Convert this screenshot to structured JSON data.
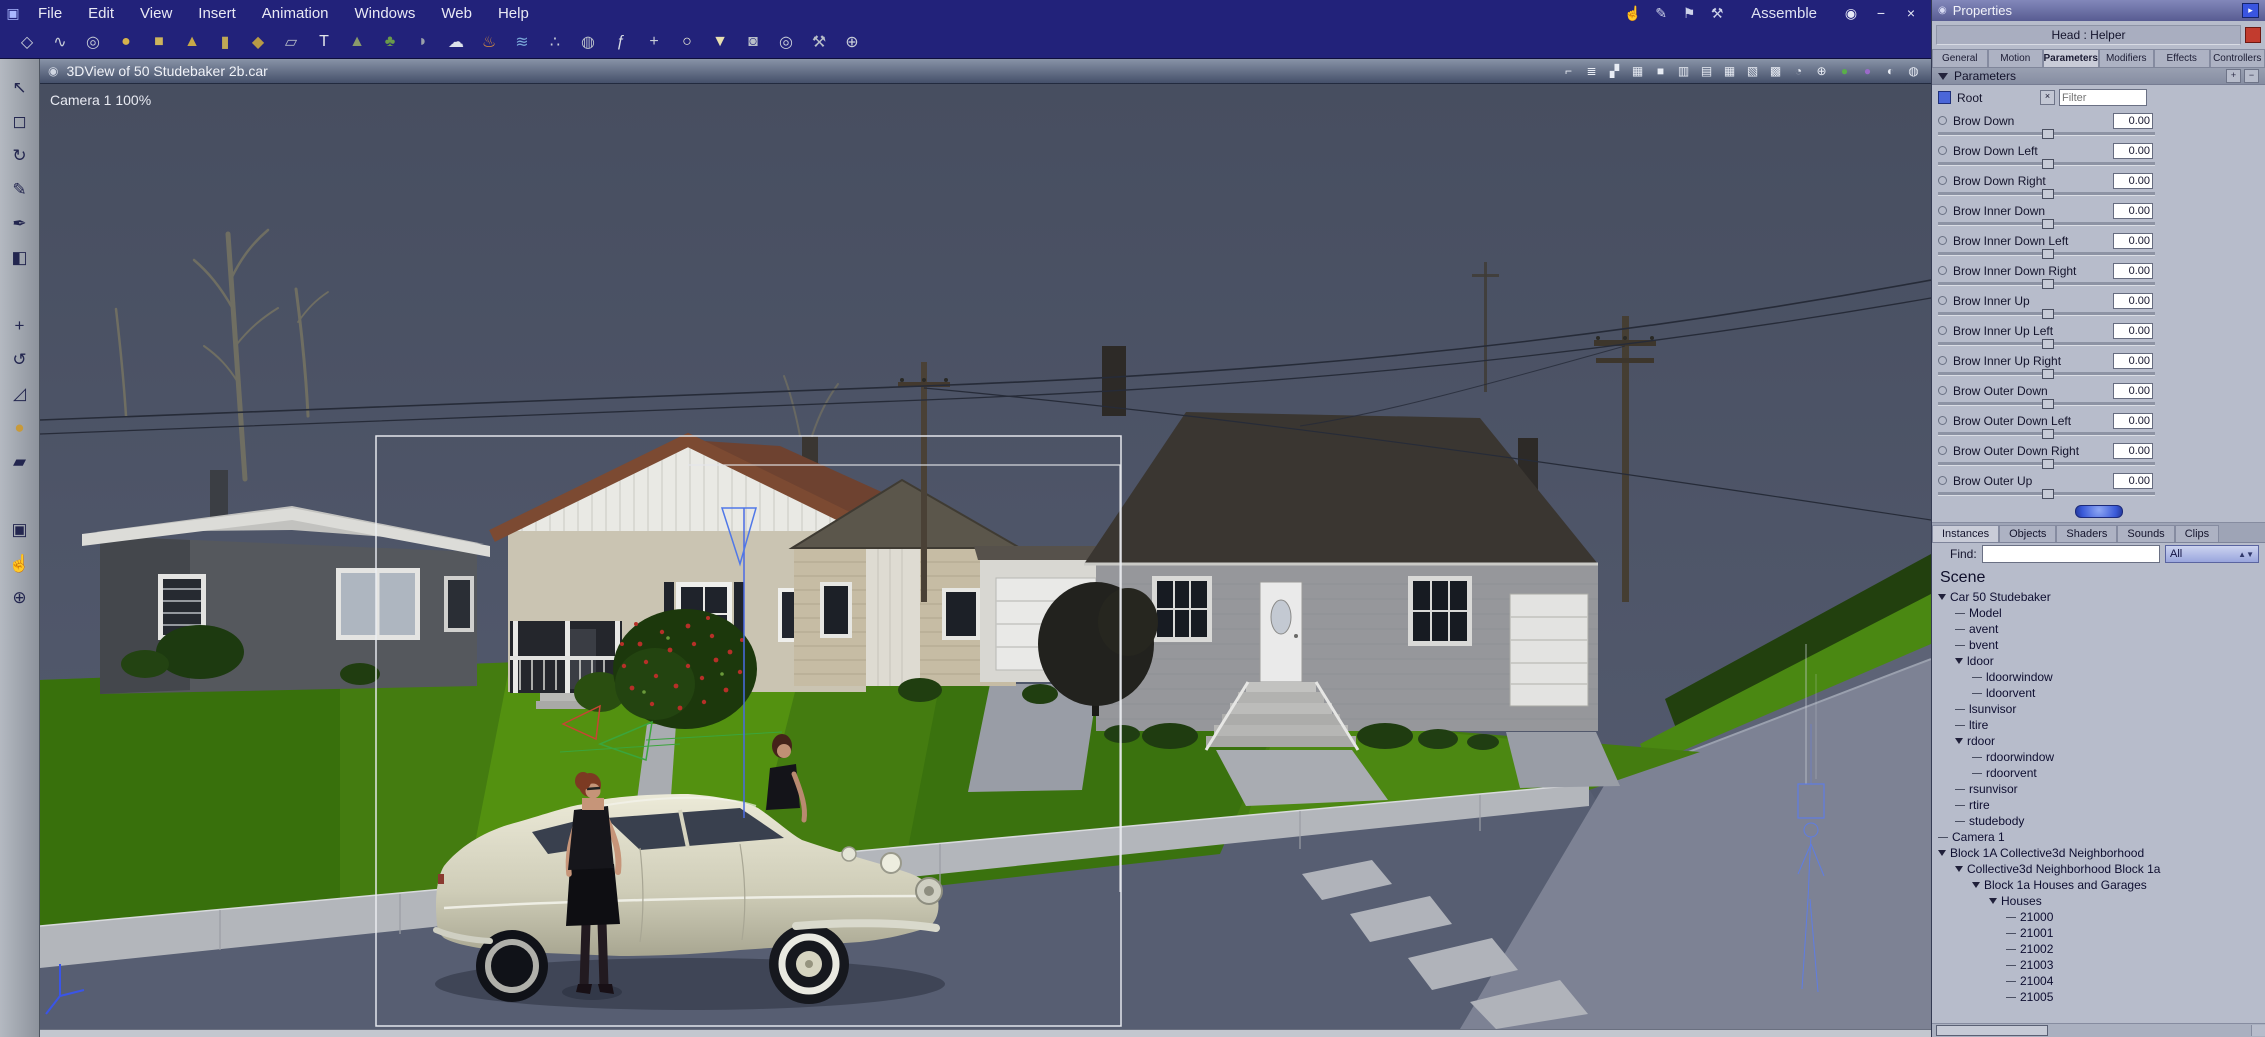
{
  "menu": {
    "items": [
      "File",
      "Edit",
      "View",
      "Insert",
      "Animation",
      "Windows",
      "Web",
      "Help"
    ],
    "right_icons": [
      {
        "name": "pan-hand-icon",
        "glyph": "☝"
      },
      {
        "name": "pen-icon",
        "glyph": "✎"
      },
      {
        "name": "flag-icon",
        "glyph": "⚑"
      },
      {
        "name": "tools-icon",
        "glyph": "⚒"
      }
    ],
    "mode_label": "Assemble",
    "window_icons": [
      {
        "name": "visibility-eye-icon",
        "glyph": "◉"
      },
      {
        "name": "minimize-button",
        "glyph": "−"
      },
      {
        "name": "close-button",
        "glyph": "×"
      }
    ]
  },
  "toolbar": {
    "tools": [
      {
        "name": "vertex-model-tool-icon",
        "glyph": "◇",
        "color": "#c8cdd8"
      },
      {
        "name": "spline-model-tool-icon",
        "glyph": "∿",
        "color": "#c8cdd8"
      },
      {
        "name": "metaball-tool-icon",
        "glyph": "◎",
        "color": "#c2c8d4"
      },
      {
        "name": "sphere-primitive-icon",
        "glyph": "●",
        "color": "#d6b24c"
      },
      {
        "name": "cube-primitive-icon",
        "glyph": "■",
        "color": "#cdb45c"
      },
      {
        "name": "cone-primitive-icon",
        "glyph": "▲",
        "color": "#c8a948"
      },
      {
        "name": "cylinder-primitive-icon",
        "glyph": "▮",
        "color": "#bfa855"
      },
      {
        "name": "icosahedron-primitive-icon",
        "glyph": "◆",
        "color": "#b89a46"
      },
      {
        "name": "plane-primitive-icon",
        "glyph": "▱",
        "color": "#b4bac6"
      },
      {
        "name": "text-primitive-icon",
        "glyph": "T",
        "color": "#e2e5ea"
      },
      {
        "name": "terrain-tool-icon",
        "glyph": "▲",
        "color": "#8a9a6a"
      },
      {
        "name": "plant-tool-icon",
        "glyph": "♣",
        "color": "#6a9a4a"
      },
      {
        "name": "rock-tool-icon",
        "glyph": "◗",
        "color": "#9aa0aa"
      },
      {
        "name": "cloud-tool-icon",
        "glyph": "☁",
        "color": "#dde2ea"
      },
      {
        "name": "fire-tool-icon",
        "glyph": "♨",
        "color": "#d89040"
      },
      {
        "name": "fountain-tool-icon",
        "glyph": "≋",
        "color": "#7aa8d8"
      },
      {
        "name": "particles-tool-icon",
        "glyph": "∴",
        "color": "#c8cdd8"
      },
      {
        "name": "blob-tool-icon",
        "glyph": "◍",
        "color": "#b8bec8"
      },
      {
        "name": "formula-tool-icon",
        "glyph": "ƒ",
        "color": "#d8dce4"
      },
      {
        "name": "modifier-tool-icon",
        "glyph": "+",
        "color": "#c8cdd8"
      },
      {
        "name": "bulb-light-tool-icon",
        "glyph": "○",
        "color": "#f0f0d8"
      },
      {
        "name": "spot-light-tool-icon",
        "glyph": "▼",
        "color": "#e8e0b0"
      },
      {
        "name": "camera-tool-icon",
        "glyph": "◙",
        "color": "#b8bec8"
      },
      {
        "name": "target-helper-tool-icon",
        "glyph": "◎",
        "color": "#c8cdd8"
      },
      {
        "name": "wrench-tool-icon",
        "glyph": "⚒",
        "color": "#b8bec8"
      },
      {
        "name": "magnifier-tool-icon",
        "glyph": "⊕",
        "color": "#c8cdd8"
      }
    ]
  },
  "left_toolbar": {
    "tools": [
      {
        "name": "pointer-tool-icon",
        "glyph": "↖"
      },
      {
        "name": "marquee-tool-icon",
        "glyph": "◻"
      },
      {
        "name": "rotate-scene-tool-icon",
        "glyph": "↻"
      },
      {
        "name": "pen-tool-icon",
        "glyph": "✎"
      },
      {
        "name": "eyedropper-tool-icon",
        "glyph": "✒"
      },
      {
        "name": "bucket-tool-icon",
        "glyph": "◧"
      },
      {
        "name": "gap-1",
        "glyph": ""
      },
      {
        "name": "move-tool-icon",
        "glyph": "+"
      },
      {
        "name": "rotate-tool-icon",
        "glyph": "↺"
      },
      {
        "name": "scale-tool-icon",
        "glyph": "◿"
      },
      {
        "name": "reference-sphere-icon",
        "glyph": "●",
        "color": "#c89a3a"
      },
      {
        "name": "shear-tool-icon",
        "glyph": "▰"
      },
      {
        "name": "gap-2",
        "glyph": ""
      },
      {
        "name": "camera-track-tool-icon",
        "glyph": "▣"
      },
      {
        "name": "hand-pan-tool-icon",
        "glyph": "☝"
      },
      {
        "name": "zoom-tool-icon",
        "glyph": "⊕"
      }
    ]
  },
  "viewport": {
    "title": "3DView of 50 Studebaker 2b.car",
    "camera_label": "Camera 1 100%",
    "title_icons": [
      {
        "name": "snap-magnet-icon",
        "glyph": "⌐"
      },
      {
        "name": "measure-icon",
        "glyph": "≣"
      },
      {
        "name": "antialias-icon",
        "glyph": "▞"
      },
      {
        "name": "grid-toggle-icon",
        "glyph": "▦"
      },
      {
        "name": "layout-full-icon",
        "glyph": "■"
      },
      {
        "name": "layout-columns-icon",
        "glyph": "▥"
      },
      {
        "name": "layout-rows-icon",
        "glyph": "▤"
      },
      {
        "name": "layout-quad-icon",
        "glyph": "▦"
      },
      {
        "name": "layout-three-icon",
        "glyph": "▧"
      },
      {
        "name": "layout-custom-icon",
        "glyph": "▩"
      },
      {
        "name": "timer-icon",
        "glyph": "◔"
      },
      {
        "name": "axis-toggle-icon",
        "glyph": "⊕"
      },
      {
        "name": "preview-sphere-green-icon",
        "glyph": "●",
        "color": "#5aae4a"
      },
      {
        "name": "preview-sphere-purple-icon",
        "glyph": "●",
        "color": "#9a6ac8"
      },
      {
        "name": "render-mode-icon",
        "glyph": "◐"
      },
      {
        "name": "info-icon",
        "glyph": "◍"
      }
    ]
  },
  "properties": {
    "panel_title": "Properties",
    "selection_label": "Head : Helper",
    "tabs": [
      {
        "label": "General"
      },
      {
        "label": "Motion"
      },
      {
        "label": "Parameters",
        "selected": true
      },
      {
        "label": "Modifiers"
      },
      {
        "label": "Effects"
      },
      {
        "label": "Controllers"
      }
    ],
    "section_title": "Parameters",
    "root_label": "Root",
    "filter_placeholder": "Filter",
    "params": [
      {
        "label": "Brow Down",
        "value": "0.00"
      },
      {
        "label": "Brow Down Left",
        "value": "0.00"
      },
      {
        "label": "Brow Down Right",
        "value": "0.00"
      },
      {
        "label": "Brow Inner Down",
        "value": "0.00"
      },
      {
        "label": "Brow Inner Down Left",
        "value": "0.00"
      },
      {
        "label": "Brow Inner Down Right",
        "value": "0.00"
      },
      {
        "label": "Brow Inner Up",
        "value": "0.00"
      },
      {
        "label": "Brow Inner Up Left",
        "value": "0.00"
      },
      {
        "label": "Brow Inner Up Right",
        "value": "0.00"
      },
      {
        "label": "Brow Outer Down",
        "value": "0.00"
      },
      {
        "label": "Brow Outer Down Left",
        "value": "0.00"
      },
      {
        "label": "Brow Outer Down Right",
        "value": "0.00"
      },
      {
        "label": "Brow Outer Up",
        "value": "0.00"
      }
    ]
  },
  "browser": {
    "tabs": [
      {
        "label": "Instances",
        "selected": true
      },
      {
        "label": "Objects"
      },
      {
        "label": "Shaders"
      },
      {
        "label": "Sounds"
      },
      {
        "label": "Clips"
      }
    ],
    "find_label": "Find:",
    "find_value": "",
    "scope_value": "All",
    "scene_label": "Scene",
    "tree": [
      {
        "label": "Car 50 Studebaker",
        "depth": 0,
        "expander": true
      },
      {
        "label": "Model",
        "depth": 1
      },
      {
        "label": "avent",
        "depth": 1
      },
      {
        "label": "bvent",
        "depth": 1
      },
      {
        "label": "ldoor",
        "depth": 1,
        "expander": true
      },
      {
        "label": "ldoorwindow",
        "depth": 2
      },
      {
        "label": "ldoorvent",
        "depth": 2
      },
      {
        "label": "lsunvisor",
        "depth": 1
      },
      {
        "label": "ltire",
        "depth": 1
      },
      {
        "label": "rdoor",
        "depth": 1,
        "expander": true
      },
      {
        "label": "rdoorwindow",
        "depth": 2
      },
      {
        "label": "rdoorvent",
        "depth": 2
      },
      {
        "label": "rsunvisor",
        "depth": 1
      },
      {
        "label": "rtire",
        "depth": 1
      },
      {
        "label": "studebody",
        "depth": 1
      },
      {
        "label": "Camera 1",
        "depth": 0
      },
      {
        "label": "Block 1A Collective3d Neighborhood",
        "depth": 0,
        "expander": true
      },
      {
        "label": "Collective3d Neighborhood  Block 1a",
        "depth": 1,
        "expander": true
      },
      {
        "label": "Block 1a Houses and Garages",
        "depth": 2,
        "expander": true
      },
      {
        "label": "Houses",
        "depth": 3,
        "expander": true
      },
      {
        "label": "21000",
        "depth": 4
      },
      {
        "label": "21001",
        "depth": 4
      },
      {
        "label": "21002",
        "depth": 4
      },
      {
        "label": "21003",
        "depth": 4
      },
      {
        "label": "21004",
        "depth": 4
      },
      {
        "label": "21005",
        "depth": 4
      }
    ]
  }
}
